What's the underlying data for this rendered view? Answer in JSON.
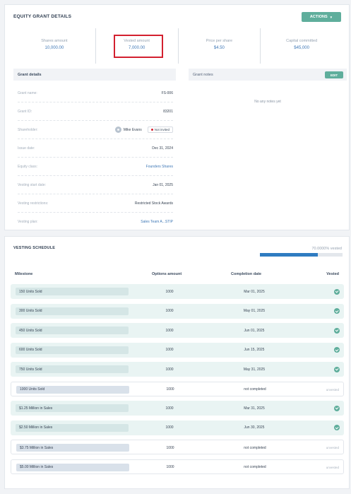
{
  "grant": {
    "title": "EQUITY GRANT DETAILS",
    "actions_label": "ACTIONS",
    "stats": [
      {
        "label": "Shares amount",
        "value": "10,000.00"
      },
      {
        "label": "Vested amount",
        "value": "7,000.00"
      },
      {
        "label": "Price per share",
        "value": "$4.50"
      },
      {
        "label": "Capital committed",
        "value": "$45,000"
      }
    ],
    "details_title": "Grant details",
    "details": [
      {
        "label": "Grant name:",
        "value": "FS-006"
      },
      {
        "label": "Grant ID:",
        "value": "83201"
      },
      {
        "label": "Shareholder:",
        "value": "Mike Evans",
        "badge": "Not invited"
      },
      {
        "label": "Issue date:",
        "value": "Dec 31, 2024"
      },
      {
        "label": "Equity class:",
        "value": "Founders Shares"
      },
      {
        "label": "Vesting start date:",
        "value": "Jan 01, 2025"
      },
      {
        "label": "Vesting restrictions:",
        "value": "Restricted Stock Awards"
      },
      {
        "label": "Vesting plan:",
        "value": "Sales Team A...STIP"
      }
    ],
    "notes_title": "Grant notes",
    "edit_label": "EDIT",
    "notes_empty": "No any notes yet"
  },
  "vesting": {
    "title": "VESTING SCHEDULE",
    "percent_label": "70.0000% vested",
    "progress_fraction": 0.7,
    "columns": {
      "milestone": "Milestone",
      "amount": "Options amount",
      "date": "Completion date",
      "vested": "Vested"
    },
    "rows": [
      {
        "milestone": "150 Units Sold",
        "amount": "1000",
        "date": "Mar 01, 2025",
        "vested": true
      },
      {
        "milestone": "300 Units Sold",
        "amount": "1000",
        "date": "May 01, 2025",
        "vested": true
      },
      {
        "milestone": "450 Units Sold",
        "amount": "1000",
        "date": "Jun 01, 2025",
        "vested": true
      },
      {
        "milestone": "600 Units Sold",
        "amount": "1000",
        "date": "Jun 15, 2025",
        "vested": true
      },
      {
        "milestone": "750 Units Sold",
        "amount": "1000",
        "date": "May 31, 2025",
        "vested": true
      },
      {
        "milestone": "1000 Units Sold",
        "amount": "1000",
        "date": "not completed",
        "vested": false
      },
      {
        "milestone": "$1.25 Million in Sales",
        "amount": "1000",
        "date": "Mar 31, 2025",
        "vested": true
      },
      {
        "milestone": "$2.50 Million in Sales",
        "amount": "1000",
        "date": "Jun 30, 2025",
        "vested": true
      },
      {
        "milestone": "$3.75 Million in Sales",
        "amount": "1000",
        "date": "not completed",
        "vested": false
      },
      {
        "milestone": "$5.00 Million in Sales",
        "amount": "1000",
        "date": "not completed",
        "vested": false
      }
    ],
    "unvested_label": "unvested"
  },
  "colors": {
    "accent": "#5fae9c",
    "link": "#3f78b6",
    "highlight": "#d3202f",
    "progress": "#2f7cc1"
  },
  "icons": {
    "vested": "check-circle-icon",
    "shareholder": "user-avatar-icon",
    "actions": "caret-down-icon"
  }
}
